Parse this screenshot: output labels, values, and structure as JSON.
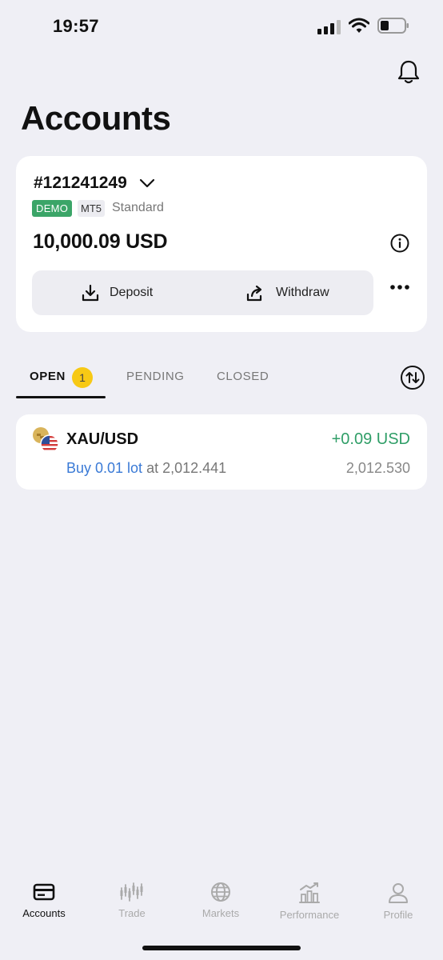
{
  "status_bar": {
    "time": "19:57"
  },
  "header": {
    "title": "Accounts"
  },
  "account": {
    "number": "#121241249",
    "badge_demo": "DEMO",
    "badge_platform": "MT5",
    "type": "Standard",
    "balance": "10,000.09 USD",
    "deposit_label": "Deposit",
    "withdraw_label": "Withdraw"
  },
  "tabs": {
    "open_label": "OPEN",
    "open_count": "1",
    "pending_label": "PENDING",
    "closed_label": "CLOSED"
  },
  "positions": [
    {
      "symbol": "XAU/USD",
      "pnl": "+0.09 USD",
      "side": "Buy 0.01 lot",
      "at_text": " at 2,012.441",
      "current_price": "2,012.530"
    }
  ],
  "nav": {
    "items": [
      {
        "label": "Accounts",
        "icon": "accounts-icon",
        "active": true
      },
      {
        "label": "Trade",
        "icon": "trade-icon"
      },
      {
        "label": "Markets",
        "icon": "globe-icon"
      },
      {
        "label": "Performance",
        "icon": "performance-icon"
      },
      {
        "label": "Profile",
        "icon": "profile-icon"
      }
    ]
  },
  "colors": {
    "background": "#efeff5",
    "profit": "#2f9e67",
    "buy": "#3a7ad6",
    "demo_badge": "#3ba568",
    "count_badge": "#f7c915"
  }
}
